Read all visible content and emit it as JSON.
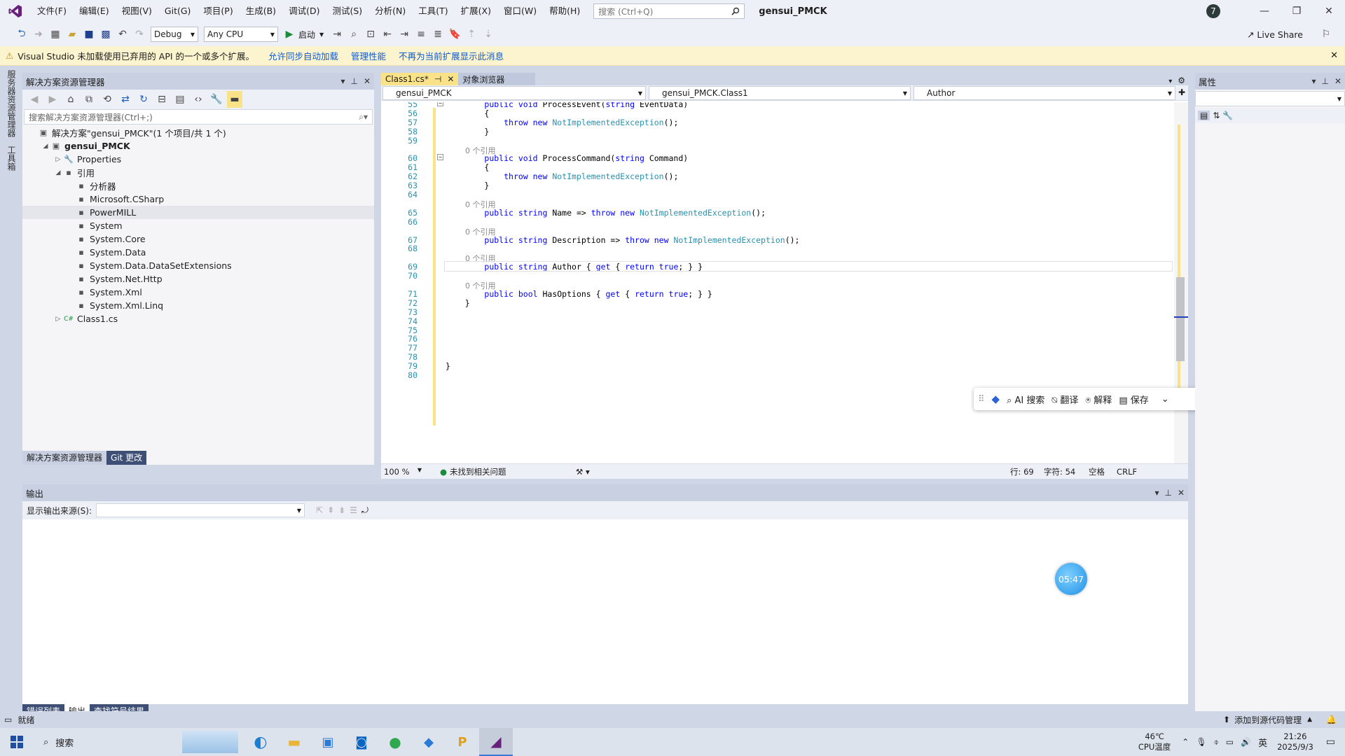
{
  "menubar": {
    "items": [
      "文件(F)",
      "编辑(E)",
      "视图(V)",
      "Git(G)",
      "项目(P)",
      "生成(B)",
      "调试(D)",
      "测试(S)",
      "分析(N)",
      "工具(T)",
      "扩展(X)",
      "窗口(W)",
      "帮助(H)"
    ],
    "search_placeholder": "搜索 (Ctrl+Q)",
    "solution_name": "gensui_PMCK",
    "avatar_letter": "7"
  },
  "toolbar": {
    "config": "Debug",
    "platform": "Any CPU",
    "start_label": "启动",
    "live_share": "Live Share"
  },
  "infobar": {
    "message": "Visual Studio 未加载使用已弃用的 API 的一个或多个扩展。",
    "link1": "允许同步自动加载",
    "link2": "管理性能",
    "link3": "不再为当前扩展显示此消息"
  },
  "leftstrip": {
    "tab1": "服务器资源管理器",
    "tab2": "工具箱"
  },
  "solution_explorer": {
    "title": "解决方案资源管理器",
    "search_placeholder": "搜索解决方案资源管理器(Ctrl+;)",
    "tree": [
      {
        "label": "解决方案\"gensui_PMCK\"(1 个项目/共 1 个)",
        "indent": 0,
        "expander": "",
        "icon": "▣",
        "bold": false,
        "selected": false
      },
      {
        "label": "gensui_PMCK",
        "indent": 1,
        "expander": "◢",
        "icon": "▣",
        "bold": true,
        "selected": false
      },
      {
        "label": "Properties",
        "indent": 2,
        "expander": "▷",
        "icon": "🔧",
        "bold": false,
        "selected": false
      },
      {
        "label": "引用",
        "indent": 2,
        "expander": "◢",
        "icon": "▪",
        "bold": false,
        "selected": false
      },
      {
        "label": "分析器",
        "indent": 3,
        "expander": "",
        "icon": "▪",
        "bold": false,
        "selected": false
      },
      {
        "label": "Microsoft.CSharp",
        "indent": 3,
        "expander": "",
        "icon": "▪",
        "bold": false,
        "selected": false
      },
      {
        "label": "PowerMILL",
        "indent": 3,
        "expander": "",
        "icon": "▪",
        "bold": false,
        "selected": true
      },
      {
        "label": "System",
        "indent": 3,
        "expander": "",
        "icon": "▪",
        "bold": false,
        "selected": false
      },
      {
        "label": "System.Core",
        "indent": 3,
        "expander": "",
        "icon": "▪",
        "bold": false,
        "selected": false
      },
      {
        "label": "System.Data",
        "indent": 3,
        "expander": "",
        "icon": "▪",
        "bold": false,
        "selected": false
      },
      {
        "label": "System.Data.DataSetExtensions",
        "indent": 3,
        "expander": "",
        "icon": "▪",
        "bold": false,
        "selected": false
      },
      {
        "label": "System.Net.Http",
        "indent": 3,
        "expander": "",
        "icon": "▪",
        "bold": false,
        "selected": false
      },
      {
        "label": "System.Xml",
        "indent": 3,
        "expander": "",
        "icon": "▪",
        "bold": false,
        "selected": false
      },
      {
        "label": "System.Xml.Linq",
        "indent": 3,
        "expander": "",
        "icon": "▪",
        "bold": false,
        "selected": false
      },
      {
        "label": "Class1.cs",
        "indent": 2,
        "expander": "▷",
        "icon": "C#",
        "bold": false,
        "selected": false
      }
    ],
    "bottom_tabs": [
      "解决方案资源管理器",
      "Git 更改"
    ]
  },
  "editor": {
    "tabs": [
      "Class1.cs*",
      "对象浏览器"
    ],
    "nav_project": "gensui_PMCK",
    "nav_class": "gensui_PMCK.Class1",
    "nav_member": "Author",
    "lines": [
      {
        "n": "55",
        "code": [
          [
            "        ",
            "pl"
          ],
          [
            "public void ",
            "kw"
          ],
          [
            "ProcessEvent(",
            "pl"
          ],
          [
            "string ",
            "kw"
          ],
          [
            "EventData)",
            "pl"
          ]
        ]
      },
      {
        "n": "56",
        "code": [
          [
            "        {",
            "pl"
          ]
        ]
      },
      {
        "n": "57",
        "code": [
          [
            "            ",
            "pl"
          ],
          [
            "throw new ",
            "kw"
          ],
          [
            "NotImplementedException",
            "ty"
          ],
          [
            "();",
            "pl"
          ]
        ]
      },
      {
        "n": "58",
        "code": [
          [
            "        }",
            "pl"
          ]
        ]
      },
      {
        "n": "59",
        "code": []
      },
      {
        "n": "",
        "code": [
          [
            "        0 个引用",
            "cm"
          ]
        ]
      },
      {
        "n": "60",
        "code": [
          [
            "        ",
            "pl"
          ],
          [
            "public void ",
            "kw"
          ],
          [
            "ProcessCommand(",
            "pl"
          ],
          [
            "string ",
            "kw"
          ],
          [
            "Command)",
            "pl"
          ]
        ]
      },
      {
        "n": "61",
        "code": [
          [
            "        {",
            "pl"
          ]
        ]
      },
      {
        "n": "62",
        "code": [
          [
            "            ",
            "pl"
          ],
          [
            "throw new ",
            "kw"
          ],
          [
            "NotImplementedException",
            "ty"
          ],
          [
            "();",
            "pl"
          ]
        ]
      },
      {
        "n": "63",
        "code": [
          [
            "        }",
            "pl"
          ]
        ]
      },
      {
        "n": "64",
        "code": []
      },
      {
        "n": "",
        "code": [
          [
            "        0 个引用",
            "cm"
          ]
        ]
      },
      {
        "n": "65",
        "code": [
          [
            "        ",
            "pl"
          ],
          [
            "public string ",
            "kw"
          ],
          [
            "Name => ",
            "pl"
          ],
          [
            "throw new ",
            "kw"
          ],
          [
            "NotImplementedException",
            "ty"
          ],
          [
            "();",
            "pl"
          ]
        ]
      },
      {
        "n": "66",
        "code": []
      },
      {
        "n": "",
        "code": [
          [
            "        0 个引用",
            "cm"
          ]
        ]
      },
      {
        "n": "67",
        "code": [
          [
            "        ",
            "pl"
          ],
          [
            "public string ",
            "kw"
          ],
          [
            "Description => ",
            "pl"
          ],
          [
            "throw new ",
            "kw"
          ],
          [
            "NotImplementedException",
            "ty"
          ],
          [
            "();",
            "pl"
          ]
        ]
      },
      {
        "n": "68",
        "code": []
      },
      {
        "n": "",
        "code": [
          [
            "        0 个引用",
            "cm"
          ]
        ]
      },
      {
        "n": "69",
        "code": [
          [
            "        ",
            "pl"
          ],
          [
            "public string ",
            "kw"
          ],
          [
            "Author { ",
            "pl"
          ],
          [
            "get ",
            "kw"
          ],
          [
            "{ ",
            "pl"
          ],
          [
            "return true",
            "kw"
          ],
          [
            "; } }",
            "pl"
          ]
        ]
      },
      {
        "n": "70",
        "code": []
      },
      {
        "n": "",
        "code": [
          [
            "        0 个引用",
            "cm"
          ]
        ]
      },
      {
        "n": "71",
        "code": [
          [
            "        ",
            "pl"
          ],
          [
            "public bool ",
            "kw"
          ],
          [
            "HasOptions { ",
            "pl"
          ],
          [
            "get ",
            "kw"
          ],
          [
            "{ ",
            "pl"
          ],
          [
            "return true",
            "kw"
          ],
          [
            "; } }",
            "pl"
          ]
        ]
      },
      {
        "n": "72",
        "code": [
          [
            "    }",
            "pl"
          ]
        ]
      },
      {
        "n": "73",
        "code": []
      },
      {
        "n": "74",
        "code": []
      },
      {
        "n": "75",
        "code": []
      },
      {
        "n": "76",
        "code": []
      },
      {
        "n": "77",
        "code": []
      },
      {
        "n": "78",
        "code": []
      },
      {
        "n": "79",
        "code": [
          [
            "}",
            "pl"
          ]
        ]
      },
      {
        "n": "80",
        "code": []
      }
    ],
    "zoom": "100 %",
    "issues": "未找到相关问题",
    "line_pos": "行: 69",
    "char_pos": "字符: 54",
    "space_mode": "空格",
    "eol": "CRLF"
  },
  "ai_popup": {
    "search": "AI 搜索",
    "translate": "翻译",
    "explain": "解释",
    "save": "保存"
  },
  "properties": {
    "title": "属性"
  },
  "output": {
    "title": "输出",
    "source_label": "显示输出来源(S):",
    "source_value": "",
    "bottom_tabs": [
      "错误列表",
      "输出",
      "查找符号结果"
    ]
  },
  "timer": {
    "value": "05:47"
  },
  "statusbar": {
    "status": "就绪",
    "source_control": "添加到源代码管理"
  },
  "taskbar": {
    "search": "搜索",
    "temp": "46℃",
    "temp_label": "CPU温度",
    "ime": "英",
    "time": "21:26",
    "date": "2025/9/3"
  },
  "colors": {
    "accent": "#68217a",
    "tab_active": "#f9e287",
    "keyword": "#0000ff",
    "type": "#2b91af"
  }
}
